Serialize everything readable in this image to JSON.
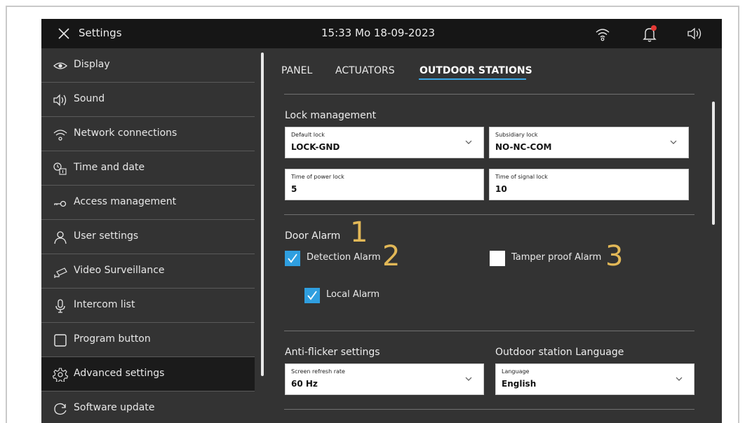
{
  "header": {
    "title": "Settings",
    "datetime": "15:33  Mo 18-09-2023",
    "notification_dot_color": "#e53935"
  },
  "sidebar": {
    "items": [
      {
        "label": "Display",
        "icon": "eye-icon"
      },
      {
        "label": "Sound",
        "icon": "speaker-icon"
      },
      {
        "label": "Network connections",
        "icon": "wifi-icon"
      },
      {
        "label": "Time and date",
        "icon": "clock-calendar-icon"
      },
      {
        "label": "Access  management",
        "icon": "key-icon"
      },
      {
        "label": "User settings",
        "icon": "user-icon"
      },
      {
        "label": "Video Surveillance",
        "icon": "camera-icon"
      },
      {
        "label": "Intercom list",
        "icon": "microphone-icon"
      },
      {
        "label": "Program button",
        "icon": "square-icon"
      },
      {
        "label": "Advanced settings",
        "icon": "gear-icon",
        "active": true
      },
      {
        "label": "Software update",
        "icon": "refresh-icon"
      }
    ]
  },
  "tabs": [
    {
      "label": "PANEL"
    },
    {
      "label": "ACTUATORS"
    },
    {
      "label": "OUTDOOR STATIONS",
      "active": true
    }
  ],
  "lock_management": {
    "title": "Lock management",
    "default_lock": {
      "caption": "Default lock",
      "value": "LOCK-GND"
    },
    "subsidiary_lock": {
      "caption": "Subsidiary lock",
      "value": "NO-NC-COM"
    },
    "power_lock_time": {
      "caption": "Time of power lock",
      "value": "5"
    },
    "signal_lock_time": {
      "caption": "Time of signal lock",
      "value": "10"
    }
  },
  "door_alarm": {
    "title": "Door Alarm",
    "detection_alarm": {
      "label": "Detection Alarm",
      "checked": true
    },
    "tamper_proof_alarm": {
      "label": "Tamper proof Alarm",
      "checked": false
    },
    "local_alarm": {
      "label": "Local  Alarm",
      "checked": true
    }
  },
  "annotations": [
    "1",
    "2",
    "3"
  ],
  "anti_flicker": {
    "title": "Anti-flicker settings",
    "refresh_rate": {
      "caption": "Screen refresh rate",
      "value": "60 Hz"
    }
  },
  "outdoor_language": {
    "title": "Outdoor station Language",
    "language": {
      "caption": "Language",
      "value": "English"
    }
  },
  "colors": {
    "accent": "#2f9fe0",
    "annotation": "#e2b857",
    "background": "#333333",
    "topbar": "#161616"
  }
}
